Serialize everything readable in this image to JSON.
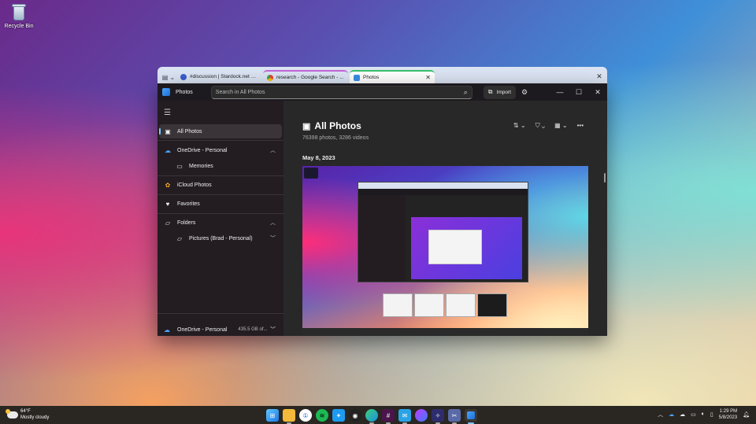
{
  "desktop": {
    "recycle_bin_label": "Recycle Bin"
  },
  "browser_tabs": [
    {
      "title": "#discussion | Stardock.net - Dis...",
      "icon_color": "#3d5ccf",
      "active": false
    },
    {
      "title": "research - Google Search - ...",
      "icon_color": "#ea4335",
      "active": false
    },
    {
      "title": "Photos",
      "icon_color": "#3a8ee6",
      "active": true
    }
  ],
  "window": {
    "app_name": "Photos",
    "search_placeholder": "Search in All Photos",
    "import_label": "Import",
    "controls": [
      "—",
      "☐",
      "✕"
    ]
  },
  "sidebar": {
    "items": [
      {
        "label": "All Photos",
        "icon": "photos-icon"
      },
      {
        "label": "OneDrive - Personal",
        "icon": "onedrive-icon"
      },
      {
        "label": "Memories",
        "icon": "memories-icon"
      },
      {
        "label": "iCloud Photos",
        "icon": "icloud-icon"
      },
      {
        "label": "Favorites",
        "icon": "heart-icon"
      },
      {
        "label": "Folders",
        "icon": "folder-icon"
      },
      {
        "label": "Pictures (Brad - Personal)",
        "icon": "folder-icon"
      }
    ],
    "storage": {
      "label": "OneDrive - Personal",
      "usage": "435.5 GB of...",
      "fill_fraction": 0.81
    }
  },
  "main": {
    "title": "All Photos",
    "subtitle": "76398 photos, 3286 videos",
    "date_group": "May 8, 2023"
  },
  "taskbar": {
    "weather_temp": "64°F",
    "weather_desc": "Mostly cloudy",
    "time": "1:29 PM",
    "date": "5/8/2023"
  },
  "colors": {
    "accent": "#7cc7ff",
    "onedrive": "#4aa3ff",
    "active_tab_indicator": "#38c16a"
  }
}
